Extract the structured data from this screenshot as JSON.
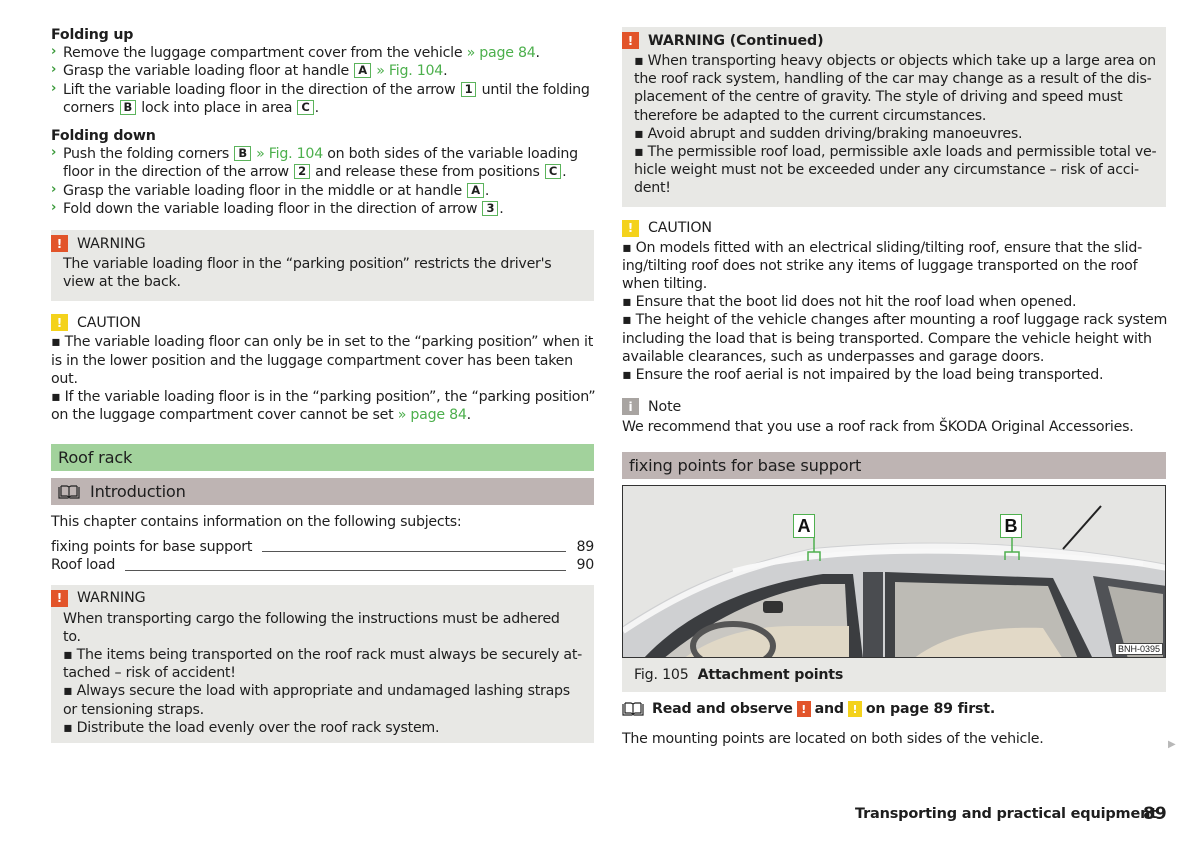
{
  "left": {
    "folding_up": {
      "title": "Folding up",
      "steps": [
        {
          "parts": [
            "Remove the luggage compartment cover from the vehicle ",
            {
              "link": "» page 84"
            },
            "."
          ]
        },
        {
          "parts": [
            "Grasp the variable loading floor at handle ",
            {
              "key": "A"
            },
            " ",
            {
              "link": "» Fig. 104"
            },
            "."
          ]
        },
        {
          "parts": [
            "Lift the variable loading floor in the direction of the arrow ",
            {
              "key": "1"
            },
            " until the folding"
          ],
          "cont": [
            "corners ",
            {
              "key": "B"
            },
            " lock into place in area ",
            {
              "key": "C"
            },
            "."
          ]
        }
      ]
    },
    "folding_down": {
      "title": "Folding down",
      "steps": [
        {
          "parts": [
            "Push the folding corners ",
            {
              "key": "B"
            },
            " ",
            {
              "link": "» Fig. 104"
            },
            " on both sides of the variable loading"
          ],
          "cont": [
            "floor in the direction of the arrow ",
            {
              "key": "2"
            },
            " and release these from positions ",
            {
              "key": "C"
            },
            "."
          ]
        },
        {
          "parts": [
            "Grasp the variable loading floor in the middle or at handle ",
            {
              "key": "A"
            },
            "."
          ]
        },
        {
          "parts": [
            "Fold down the variable loading floor in the direction of arrow ",
            {
              "key": "3"
            },
            "."
          ]
        }
      ]
    },
    "warning1": {
      "label": "WARNING",
      "lines": [
        "The variable loading floor in the “parking position” restricts the driver's",
        "view at the back."
      ]
    },
    "caution1": {
      "label": "CAUTION",
      "lines": [
        "▪ The variable loading floor can only be in set to the “parking position” when it",
        "is in the lower position and the luggage compartment cover has been taken",
        "out.",
        "▪ If the variable loading floor is in the “parking position”, the “parking position”"
      ],
      "last_line": "on the luggage compartment cover cannot be set ",
      "last_link": "» page 84",
      "last_end": "."
    },
    "section_title": "Roof rack",
    "intro_title": "Introduction",
    "intro_text": "This chapter contains information on the following subjects:",
    "toc": [
      {
        "label": "fixing points for base support",
        "page": "89"
      },
      {
        "label": "Roof load",
        "page": "90"
      }
    ],
    "warning2": {
      "label": "WARNING",
      "lines": [
        "When transporting cargo the following the instructions must be adhered",
        "to.",
        "▪ The items being transported on the roof rack must always be securely at-",
        "tached – risk of accident!",
        "▪ Always secure the load with appropriate and undamaged lashing straps",
        "or tensioning straps.",
        "▪ Distribute the load evenly over the roof rack system."
      ]
    }
  },
  "right": {
    "warning_cont": {
      "label": "WARNING (Continued)",
      "lines": [
        "▪ When transporting heavy objects or objects which take up a large area on",
        "the roof rack system, handling of the car may change as a result of the dis-",
        "placement of the centre of gravity. The style of driving and speed must",
        "therefore be adapted to the current circumstances.",
        "▪ Avoid abrupt and sudden driving/braking manoeuvres.",
        "▪ The permissible roof load, permissible axle loads and permissible total ve-",
        "hicle weight must not be exceeded under any circumstance – risk of acci-",
        "dent!"
      ]
    },
    "caution": {
      "label": "CAUTION",
      "lines": [
        "▪ On models fitted with an electrical sliding/tilting roof, ensure that the slid-",
        "ing/tilting roof does not strike any items of luggage transported on the roof",
        "when tilting.",
        "▪ Ensure that the boot lid does not hit the roof load when opened.",
        "▪ The height of the vehicle changes after mounting a roof luggage rack system",
        "including the load that is being transported. Compare the vehicle height with",
        "available clearances, such as underpasses and garage doors.",
        "▪ Ensure the roof aerial is not impaired by the load being transported."
      ]
    },
    "note": {
      "label": "Note",
      "text": "We recommend that you use a roof rack from ŠKODA Original Accessories."
    },
    "section_title": "fixing points for base support",
    "figure": {
      "callouts": [
        "A",
        "B"
      ],
      "code": "BNH-0395",
      "number": "Fig. 105",
      "title": "Attachment points"
    },
    "read_observe": {
      "prefix": "Read and observe",
      "mid": "and",
      "suffix": "on page 89 first."
    },
    "body_text": "The mounting points are located on both sides of the vehicle.",
    "continue_icon": "▶"
  },
  "footer": {
    "title": "Transporting and practical equipment",
    "page": "89"
  },
  "colors": {
    "warning": "#e2542a",
    "caution": "#f4d21b",
    "note": "#a8a4a1",
    "link": "#4caf4c",
    "section_green": "#a2d29c",
    "section_gray": "#beb4b3",
    "box_bg": "#e8e8e5"
  }
}
